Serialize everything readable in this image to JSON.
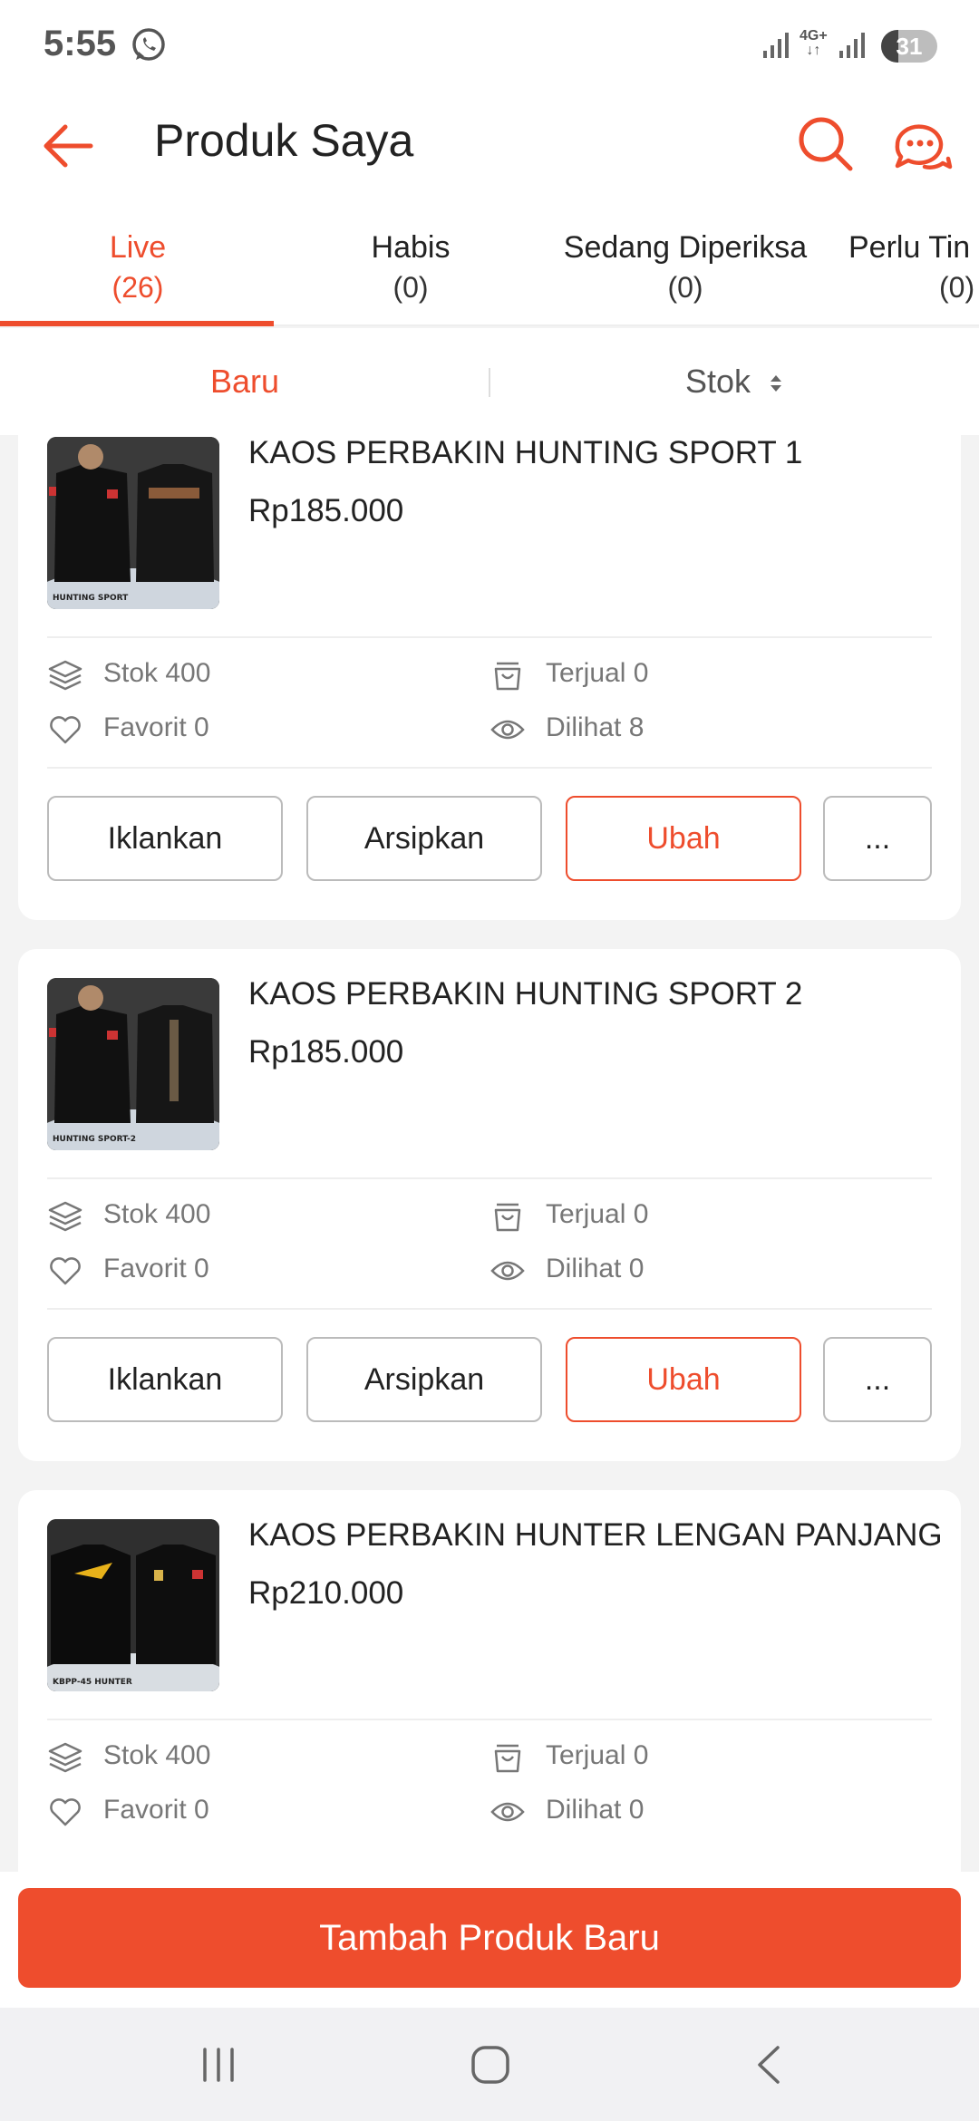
{
  "status": {
    "time": "5:55",
    "network": "4G+",
    "battery": "31",
    "battery_level": 0.31
  },
  "header": {
    "title": "Produk Saya",
    "back_icon": "arrow-left-icon",
    "search_icon": "search-icon",
    "chat_icon": "chat-icon"
  },
  "tabs": [
    {
      "label": "Live",
      "count": "(26)",
      "active": true
    },
    {
      "label": "Habis",
      "count": "(0)"
    },
    {
      "label": "Sedang Diperiksa",
      "count": "(0)"
    },
    {
      "label": "Perlu Tin",
      "count": "(0)"
    }
  ],
  "sort": {
    "new_label": "Baru",
    "stock_label": "Stok"
  },
  "products": [
    {
      "name": "KAOS PERBAKIN HUNTING SPORT 1",
      "price": "Rp185.000",
      "stock": "Stok 400",
      "sold": "Terjual 0",
      "favorite": "Favorit 0",
      "views": "Dilihat 8",
      "thumb_caption": "HUNTING SPORT"
    },
    {
      "name": "KAOS PERBAKIN HUNTING SPORT 2",
      "price": "Rp185.000",
      "stock": "Stok 400",
      "sold": "Terjual 0",
      "favorite": "Favorit 0",
      "views": "Dilihat 0",
      "thumb_caption": "HUNTING SPORT-2"
    },
    {
      "name": "KAOS PERBAKIN HUNTER LENGAN PANJANG",
      "price": "Rp210.000",
      "stock": "Stok 400",
      "sold": "Terjual 0",
      "favorite": "Favorit 0",
      "views": "Dilihat 0",
      "thumb_caption": "KBPP-45 HUNTER"
    }
  ],
  "actions": {
    "promote": "Iklankan",
    "archive": "Arsipkan",
    "edit": "Ubah",
    "more": "..."
  },
  "footer": {
    "add_product": "Tambah Produk Baru"
  },
  "colors": {
    "accent": "#ee4d2d",
    "text": "#222222",
    "muted": "#777777"
  }
}
